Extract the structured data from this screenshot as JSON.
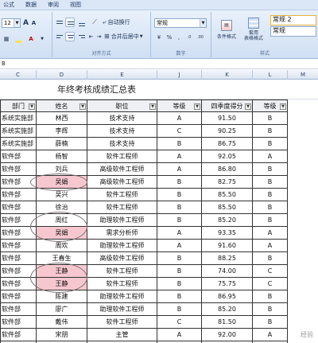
{
  "menu": {
    "tabs": [
      "公式",
      "数据",
      "审阅",
      "视图"
    ]
  },
  "ribbon": {
    "font_size": "12",
    "number_format": "常规",
    "wrap_text_label": "自动换行",
    "merge_center_label": "合并后居中",
    "conditional_format_label": "条件格式",
    "format_as_table_label": "套用\n表格格式",
    "style_normal_2": "常规 2",
    "style_normal": "常规",
    "group_alignment": "对齐方式",
    "group_number": "数字",
    "group_styles": "样式"
  },
  "formula_bar": {
    "name_box": "B"
  },
  "columns": [
    "C",
    "D",
    "E",
    "J",
    "K",
    "L",
    "M"
  ],
  "title": "年终考核成绩汇总表",
  "headers": [
    "部门",
    "姓名",
    "职位",
    "等级",
    "四季度得分",
    "等级"
  ],
  "rows": [
    [
      "系统实施部",
      "林西",
      "技术支持",
      "A",
      "91.50",
      "B"
    ],
    [
      "系统实施部",
      "李辉",
      "技术支持",
      "C",
      "90.25",
      "B"
    ],
    [
      "系统实施部",
      "薛楠",
      "技术支持",
      "B",
      "86.75",
      "B"
    ],
    [
      "软件部",
      "杨智",
      "软件工程师",
      "A",
      "92.05",
      "A"
    ],
    [
      "软件部",
      "刘兵",
      "高级软件工程师",
      "A",
      "86.80",
      "B"
    ],
    [
      "软件部",
      "吴娟",
      "高级软件工程师",
      "B",
      "82.75",
      "B"
    ],
    [
      "软件部",
      "吴兴",
      "软件工程师",
      "B",
      "85.50",
      "B"
    ],
    [
      "软件部",
      "徐治",
      "软件工程师",
      "B",
      "85.50",
      "B"
    ],
    [
      "软件部",
      "周红",
      "助理软件工程师",
      "B",
      "85.20",
      "B"
    ],
    [
      "软件部",
      "吴娟",
      "需求分析师",
      "A",
      "93.35",
      "A"
    ],
    [
      "软件部",
      "周欢",
      "助理软件工程师",
      "A",
      "91.60",
      "A"
    ],
    [
      "软件部",
      "王春生",
      "高级软件工程师",
      "B",
      "88.25",
      "B"
    ],
    [
      "软件部",
      "王静",
      "软件工程师",
      "B",
      "74.00",
      "C"
    ],
    [
      "软件部",
      "王静",
      "软件工程师",
      "B",
      "75.75",
      "C"
    ],
    [
      "软件部",
      "陈建",
      "助理软件工程师",
      "B",
      "86.95",
      "B"
    ],
    [
      "软件部",
      "廖广",
      "助理软件工程师",
      "B",
      "85.20",
      "B"
    ],
    [
      "软件部",
      "戴伟",
      "软件工程师",
      "C",
      "81.50",
      "B"
    ],
    [
      "软件部",
      "宋朋",
      "主管",
      "A",
      "92.00",
      "A"
    ],
    [
      "软件部",
      "邱忠",
      "软件工程师",
      "B",
      "85.00",
      "B"
    ]
  ],
  "highlighted_rows": [
    5,
    9,
    12,
    13
  ],
  "colors": {
    "highlight": "#f7c7cf",
    "ribbon": "#dbe7f6"
  },
  "watermark": "经验"
}
